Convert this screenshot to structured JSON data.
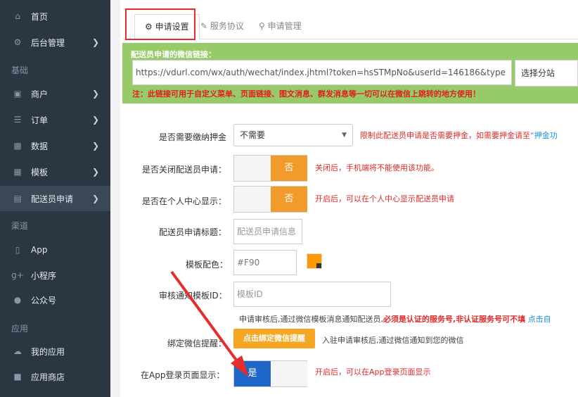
{
  "sidebar": {
    "home": "首页",
    "admin": "后台管理",
    "group_basic": "基础",
    "merchant": "商户",
    "order": "订单",
    "data": "数据",
    "template": "模板",
    "delivery_apply": "配送员申请",
    "group_channel": "渠道",
    "app": "App",
    "mini_program": "小程序",
    "official_account": "公众号",
    "group_application": "应用",
    "my_apps": "我的应用",
    "app_store": "应用商店"
  },
  "tabs": {
    "apply_settings": "申请设置",
    "service_agreement": "服务协议",
    "apply_management": "申请管理"
  },
  "wechat_link": {
    "title": "配送员申请的微信链接：",
    "url": "https://vdurl.com/wx/auth/wechat/index.jhtml?token=hsSTMpNo&userId=146186&type",
    "station_select": "选择分站",
    "note": "注：此链接可用于自定义菜单、页面链接、图文消息、群发消息等一切可以在微信上跳转的地方使用！"
  },
  "form": {
    "deposit_label": "是否需要缴纳押金",
    "deposit_value": "不需要",
    "deposit_hint": "限制此配送员申请是否需要押金，如需要押金请至",
    "deposit_link": "“押金功",
    "close_label": "是否关闭配送员申请：",
    "close_value": "否",
    "close_hint": "关闭后，手机端将不能使用该功能。",
    "center_label": "是否在个人中心显示：",
    "center_value": "否",
    "center_hint": "开启后，可以在个人中心显示配送员申请",
    "title_label": "配送员申请标题：",
    "title_placeholder": "配送员申请信息",
    "color_label": "模板配色：",
    "color_value": "#F90",
    "template_id_label": "审核通知模板ID：",
    "template_id_placeholder": "模板ID",
    "template_note_dark": "申请审核后,通过微信模板消息通知配送员,",
    "template_note_red": "必须是认证的服务号,非认证服务号可不填",
    "template_note_link": "点击自",
    "bind_label": "绑定微信提醒：",
    "bind_button": "点击绑定微信提醒",
    "bind_hint": "入驻申请审核后,通过微信通知到您的微信",
    "app_login_label": "在App登录页面显示：",
    "app_login_value": "是",
    "app_login_hint": "开启后，可以在App登录页面显示"
  },
  "colors": {
    "sidebar_bg": "#2b3643",
    "green_box": "#97cb6a",
    "toggle_off": "#f29a2a",
    "toggle_on": "#1e66c8",
    "highlight": "#e52d2d",
    "color_swatch": "#F90"
  },
  "icons": {
    "home": "home-icon",
    "admin": "gears-icon",
    "merchant": "laptop-icon",
    "order": "list-icon",
    "data": "bar-chart-icon",
    "template": "grid-icon",
    "delivery_apply": "document-icon",
    "app": "phone-icon",
    "mini_program": "google-plus-icon",
    "official_account": "chat-icon",
    "my_apps": "cloud-icon",
    "app_store": "shopping-bag-icon"
  }
}
